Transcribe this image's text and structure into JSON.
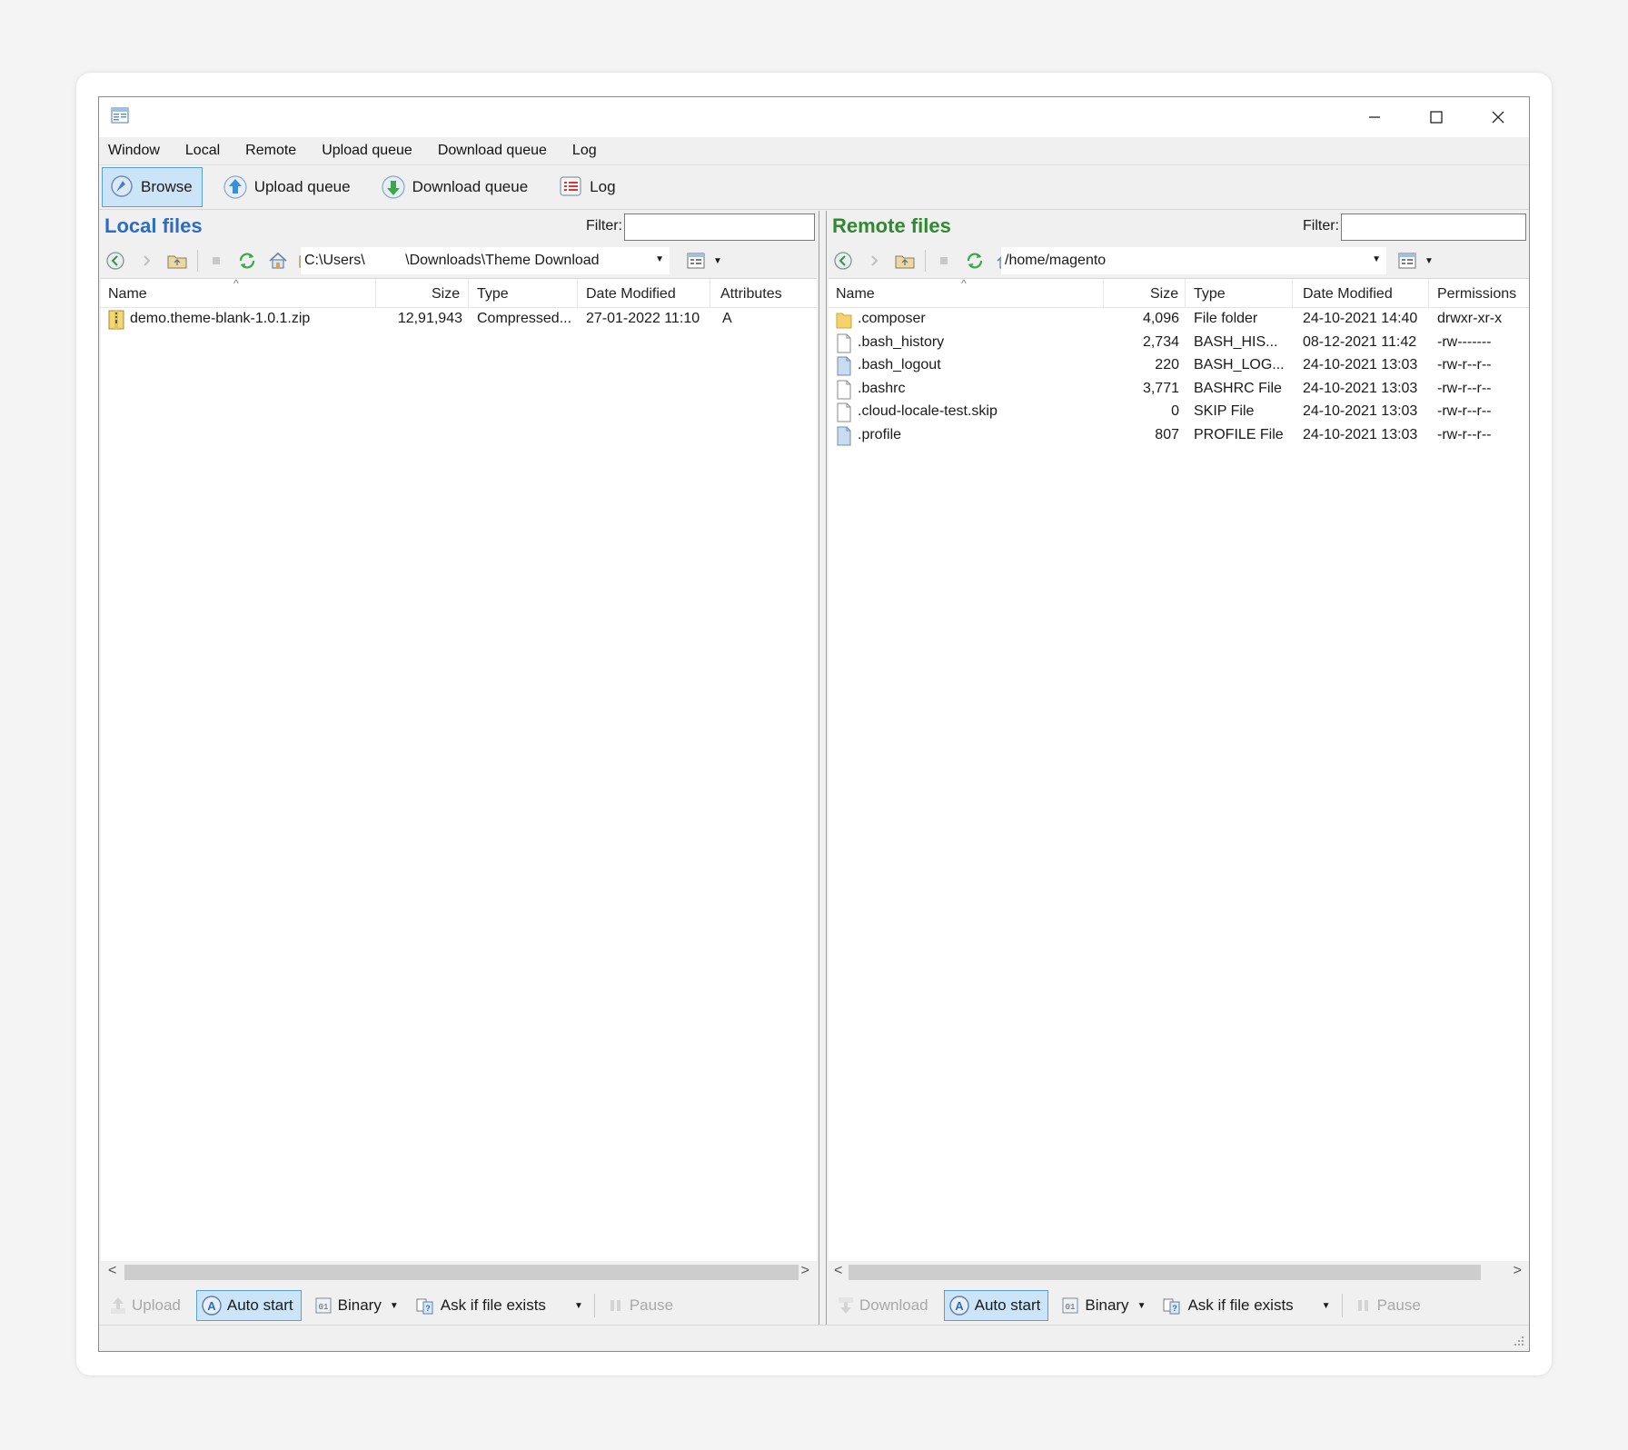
{
  "menu": [
    "Window",
    "Local",
    "Remote",
    "Upload queue",
    "Download queue",
    "Log"
  ],
  "toolbar": {
    "browse": "Browse",
    "upload_queue": "Upload queue",
    "download_queue": "Download queue",
    "log": "Log"
  },
  "local": {
    "title": "Local files",
    "filter_label": "Filter:",
    "filter_value": "",
    "path": "C:\\Users\\          \\Downloads\\Theme Download",
    "columns": [
      "Name",
      "Size",
      "Type",
      "Date Modified",
      "Attributes"
    ],
    "rows": [
      {
        "name": "demo.theme-blank-1.0.1.zip",
        "size": "12,91,943",
        "type": "Compressed...",
        "date": "27-01-2022 11:10",
        "attr": "A",
        "icon": "zip-file-icon"
      }
    ],
    "queue": {
      "upload": "Upload",
      "auto_start": "Auto start",
      "binary": "Binary",
      "ask": "Ask if file exists",
      "pause": "Pause"
    }
  },
  "remote": {
    "title": "Remote files",
    "filter_label": "Filter:",
    "filter_value": "",
    "path": "/home/magento",
    "columns": [
      "Name",
      "Size",
      "Type",
      "Date Modified",
      "Permissions"
    ],
    "rows": [
      {
        "name": ".composer",
        "size": "4,096",
        "type": "File folder",
        "date": "24-10-2021 14:40",
        "perm": "drwxr-xr-x",
        "icon": "folder-icon"
      },
      {
        "name": ".bash_history",
        "size": "2,734",
        "type": "BASH_HIS...",
        "date": "08-12-2021 11:42",
        "perm": "-rw-------",
        "icon": "file-icon"
      },
      {
        "name": ".bash_logout",
        "size": "220",
        "type": "BASH_LOG...",
        "date": "24-10-2021 13:03",
        "perm": "-rw-r--r--",
        "icon": "config-file-icon"
      },
      {
        "name": ".bashrc",
        "size": "3,771",
        "type": "BASHRC File",
        "date": "24-10-2021 13:03",
        "perm": "-rw-r--r--",
        "icon": "file-icon"
      },
      {
        "name": ".cloud-locale-test.skip",
        "size": "0",
        "type": "SKIP File",
        "date": "24-10-2021 13:03",
        "perm": "-rw-r--r--",
        "icon": "file-icon"
      },
      {
        "name": ".profile",
        "size": "807",
        "type": "PROFILE File",
        "date": "24-10-2021 13:03",
        "perm": "-rw-r--r--",
        "icon": "config-file-icon"
      }
    ],
    "queue": {
      "download": "Download",
      "auto_start": "Auto start",
      "binary": "Binary",
      "ask": "Ask if file exists",
      "pause": "Pause"
    }
  },
  "colors": {
    "local_title": "#2b6cc4",
    "remote_title": "#2f8a2f",
    "active_bg": "#cce4f7",
    "active_border": "#5aa0d8"
  }
}
